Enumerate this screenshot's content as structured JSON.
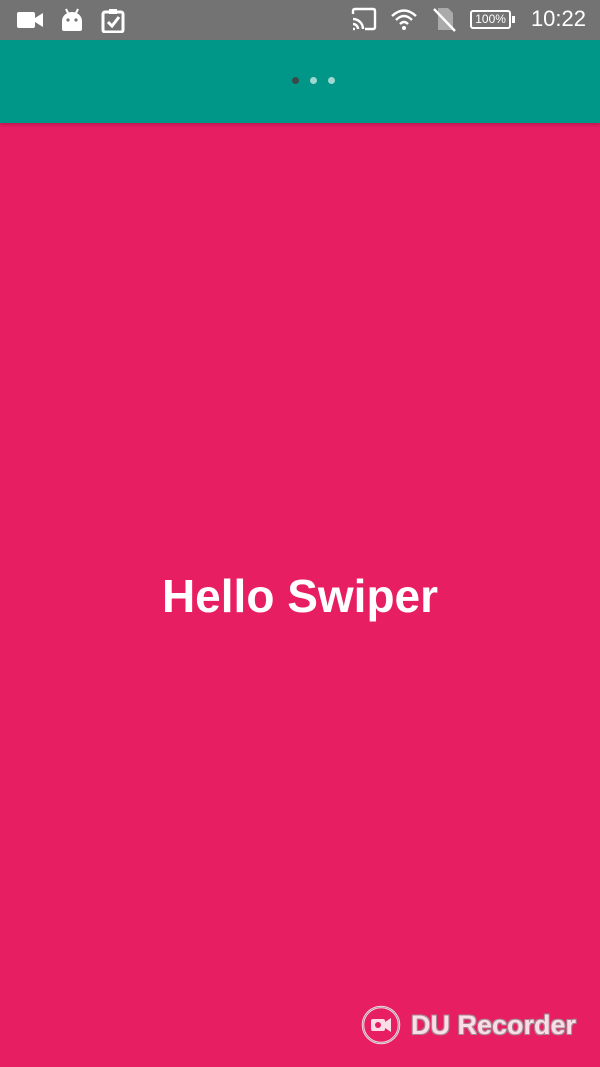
{
  "status_bar": {
    "left_icons": [
      "video-camera-icon",
      "android-icon",
      "clipboard-check-icon"
    ],
    "right_icons": [
      "cast-icon",
      "wifi-icon",
      "no-sim-icon"
    ],
    "battery_label": "100%",
    "time": "10:22"
  },
  "pager": {
    "total": 3,
    "active_index": 0
  },
  "slide": {
    "title": "Hello Swiper"
  },
  "watermark": {
    "text": "DU Recorder"
  },
  "colors": {
    "status_bar": "#737373",
    "app_bar": "#009688",
    "slide_background": "#e81e63",
    "text": "#ffffff"
  }
}
